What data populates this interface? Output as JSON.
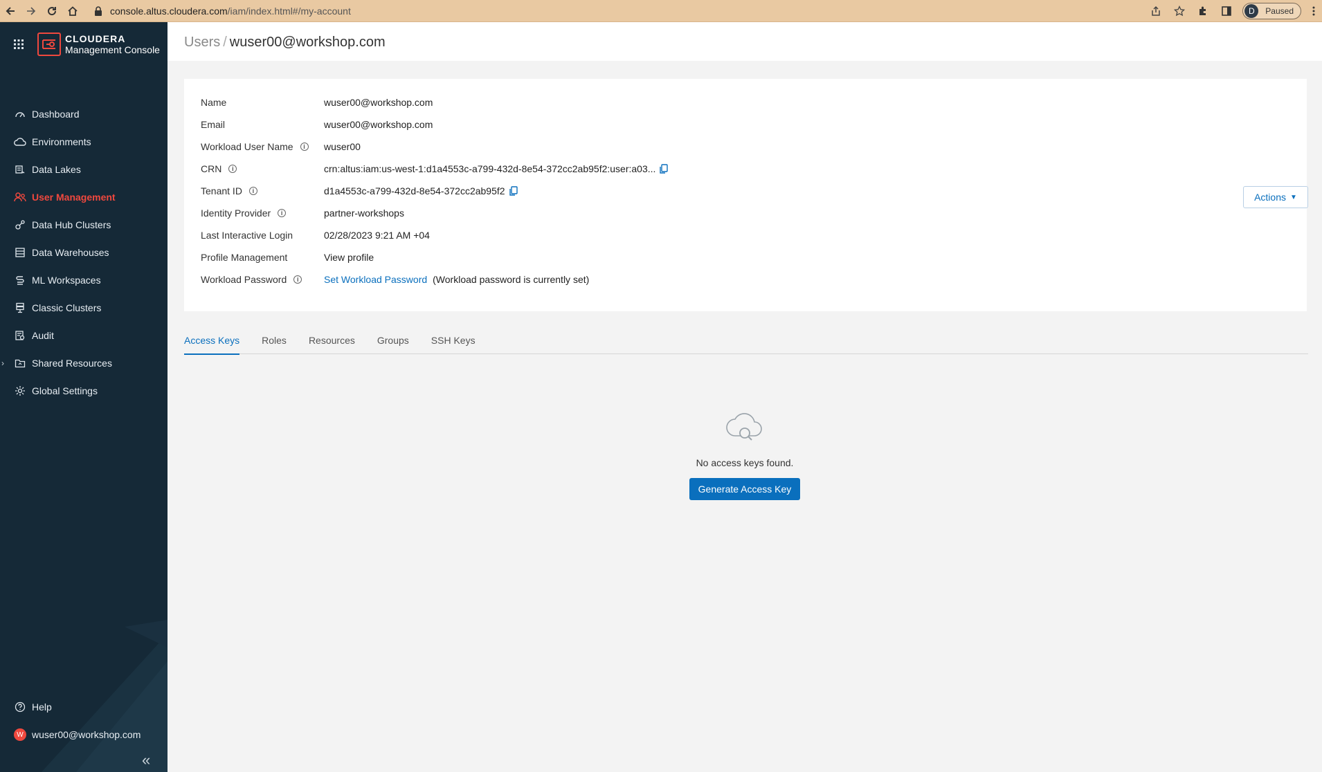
{
  "browser": {
    "url_host": "console.altus.cloudera.com",
    "url_path": "/iam/index.html#/my-account",
    "profile_initial": "D",
    "profile_status": "Paused"
  },
  "sidebar": {
    "brand_name": "CLOUDERA",
    "brand_product": "Management Console",
    "items": [
      {
        "label": "Dashboard",
        "icon": "dashboard-icon"
      },
      {
        "label": "Environments",
        "icon": "cloud-icon"
      },
      {
        "label": "Data Lakes",
        "icon": "data-lakes-icon"
      },
      {
        "label": "User Management",
        "icon": "users-icon"
      },
      {
        "label": "Data Hub Clusters",
        "icon": "data-hub-icon"
      },
      {
        "label": "Data Warehouses",
        "icon": "warehouse-icon"
      },
      {
        "label": "ML Workspaces",
        "icon": "ml-icon"
      },
      {
        "label": "Classic Clusters",
        "icon": "server-icon"
      },
      {
        "label": "Audit",
        "icon": "audit-icon"
      },
      {
        "label": "Shared Resources",
        "icon": "folder-icon"
      },
      {
        "label": "Global Settings",
        "icon": "gear-icon"
      }
    ],
    "help_label": "Help",
    "user_initial": "W",
    "user_label": "wuser00@workshop.com"
  },
  "header": {
    "crumb_parent": "Users",
    "crumb_separator": "/",
    "crumb_current": "wuser00@workshop.com"
  },
  "details": {
    "name_label": "Name",
    "name_value": "wuser00@workshop.com",
    "email_label": "Email",
    "email_value": "wuser00@workshop.com",
    "workload_user_label": "Workload User Name",
    "workload_user_value": "wuser00",
    "crn_label": "CRN",
    "crn_value": "crn:altus:iam:us-west-1:d1a4553c-a799-432d-8e54-372cc2ab95f2:user:a03...",
    "tenant_label": "Tenant ID",
    "tenant_value": "d1a4553c-a799-432d-8e54-372cc2ab95f2",
    "idp_label": "Identity Provider",
    "idp_value": "partner-workshops",
    "last_login_label": "Last Interactive Login",
    "last_login_value": "02/28/2023 9:21 AM +04",
    "profile_mgmt_label": "Profile Management",
    "profile_mgmt_link": "View profile",
    "password_label": "Workload Password",
    "password_link": "Set Workload Password",
    "password_note": "(Workload password is currently set)",
    "actions_label": "Actions"
  },
  "tabs": [
    "Access Keys",
    "Roles",
    "Resources",
    "Groups",
    "SSH Keys"
  ],
  "empty_state": {
    "message": "No access keys found.",
    "button": "Generate Access Key"
  }
}
